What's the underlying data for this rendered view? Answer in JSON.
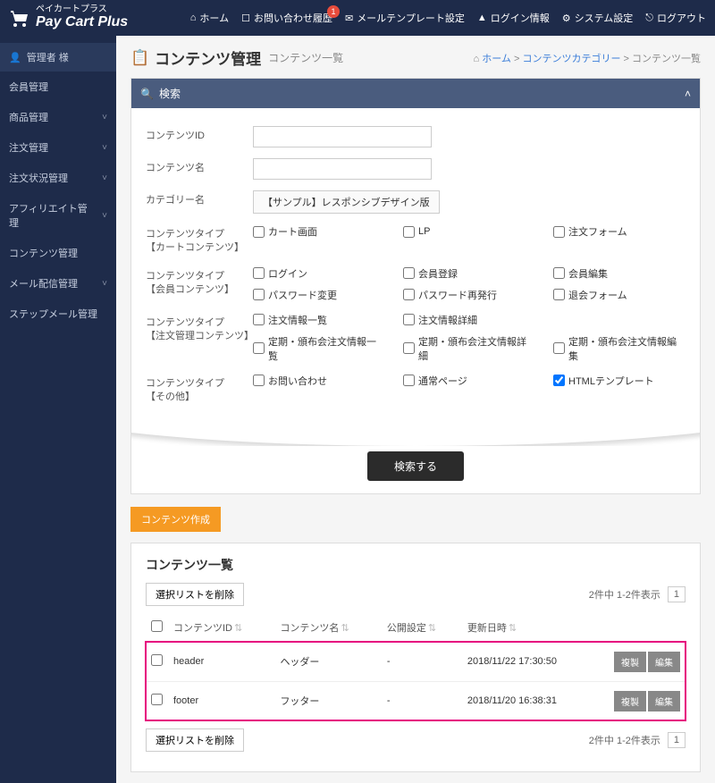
{
  "brand": {
    "tagline": "ペイカートプラス",
    "name": "Pay Cart Plus"
  },
  "topnav": {
    "home": "ホーム",
    "inquiry": "お問い合わせ履歴",
    "inquiry_badge": "1",
    "mail_template": "メールテンプレート設定",
    "login_info": "ログイン情報",
    "system": "システム設定",
    "logout": "ログアウト"
  },
  "sidebar": {
    "user": "管理者 様",
    "items": [
      "会員管理",
      "商品管理",
      "注文管理",
      "注文状況管理",
      "アフィリエイト管理",
      "コンテンツ管理",
      "メール配信管理",
      "ステップメール管理"
    ]
  },
  "page": {
    "title": "コンテンツ管理",
    "subtitle": "コンテンツ一覧"
  },
  "breadcrumb": {
    "home": "ホーム",
    "cat": "コンテンツカテゴリー",
    "current": "コンテンツ一覧"
  },
  "search": {
    "panel_title": "検索",
    "labels": {
      "id": "コンテンツID",
      "name": "コンテンツ名",
      "category": "カテゴリー名",
      "cart": "コンテンツタイプ\n【カートコンテンツ】",
      "member": "コンテンツタイプ\n【会員コンテンツ】",
      "order": "コンテンツタイプ\n【注文管理コンテンツ】",
      "other": "コンテンツタイプ\n【その他】"
    },
    "category_value": "【サンプル】レスポンシブデザイン版",
    "cart_opts": [
      "カート画面",
      "LP",
      "注文フォーム"
    ],
    "member_opts": [
      "ログイン",
      "会員登録",
      "会員編集",
      "パスワード変更",
      "パスワード再発行",
      "退会フォーム"
    ],
    "order_opts": [
      "注文情報一覧",
      "注文情報詳細",
      "",
      "定期・頒布会注文情報一覧",
      "定期・頒布会注文情報詳細",
      "定期・頒布会注文情報編集"
    ],
    "other_opts": [
      "お問い合わせ",
      "通常ページ",
      "HTMLテンプレート"
    ],
    "other_checked": [
      false,
      false,
      true
    ],
    "button": "検索する"
  },
  "create_button": "コンテンツ作成",
  "list": {
    "title": "コンテンツ一覧",
    "delete_btn": "選択リストを削除",
    "info": "2件中 1-2件表示",
    "page": "1",
    "columns": [
      "コンテンツID",
      "コンテンツ名",
      "公開設定",
      "更新日時"
    ],
    "rows": [
      {
        "id": "header",
        "name": "ヘッダー",
        "publish": "-",
        "updated": "2018/11/22 17:30:50"
      },
      {
        "id": "footer",
        "name": "フッター",
        "publish": "-",
        "updated": "2018/11/20 16:38:31"
      }
    ],
    "copy": "複製",
    "edit": "編集"
  }
}
